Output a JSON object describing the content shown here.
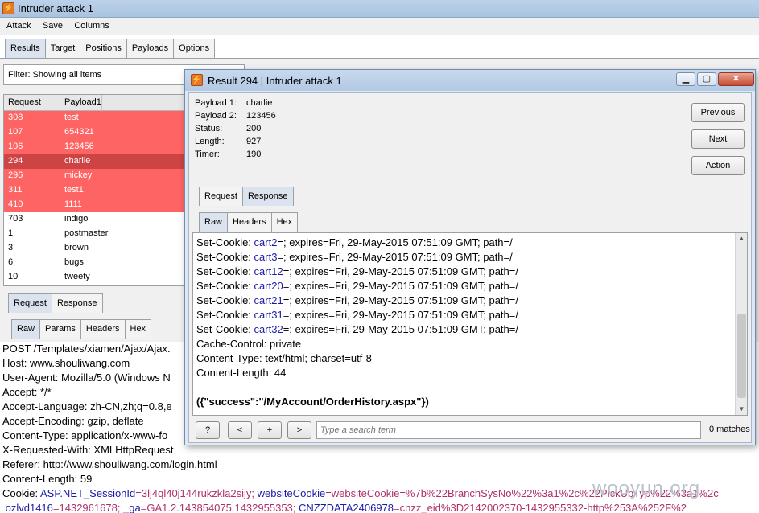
{
  "window": {
    "title": "Intruder attack 1",
    "icon": "burp-logo-icon"
  },
  "menu": [
    "Attack",
    "Save",
    "Columns"
  ],
  "main_tabs": [
    "Results",
    "Target",
    "Positions",
    "Payloads",
    "Options"
  ],
  "filter_text": "Filter:  Showing all items",
  "results": {
    "columns": [
      "Request",
      "Payload1"
    ],
    "rows": [
      [
        "308",
        "test"
      ],
      [
        "107",
        "654321"
      ],
      [
        "106",
        "123456"
      ],
      [
        "294",
        "charlie"
      ],
      [
        "296",
        "mickey"
      ],
      [
        "311",
        "test1"
      ],
      [
        "410",
        "1111"
      ],
      [
        "703",
        "indigo"
      ],
      [
        "1",
        "postmaster"
      ],
      [
        "3",
        "brown"
      ],
      [
        "6",
        "bugs"
      ],
      [
        "10",
        "tweety"
      ]
    ]
  },
  "req_tabs": [
    "Request",
    "Response"
  ],
  "req_sub_tabs": [
    "Raw",
    "Params",
    "Headers",
    "Hex"
  ],
  "request_lines": [
    "POST /Templates/xiamen/Ajax/Ajax.",
    "Host: www.shouliwang.com",
    "User-Agent: Mozilla/5.0 (Windows N",
    "Accept: */*",
    "Accept-Language: zh-CN,zh;q=0.8,e",
    "Accept-Encoding: gzip, deflate",
    "Content-Type: application/x-www-fo",
    "X-Requested-With: XMLHttpRequest",
    "Referer: http://www.shouliwang.com/login.html",
    "Content-Length: 59"
  ],
  "cookie_line": {
    "prefix": "Cookie: ",
    "k1": "ASP.NET_SessionId",
    "v1": "=3lj4ql40j144rukzkla2sijy;",
    "k2": " websiteCookie",
    "v2": "=websiteCookie=%7b%22BranchSysNo%22%3a1%2c%22PickUpTyp%22%3a1%2c"
  },
  "cookie_line2": {
    "k1": "ozlvd1416",
    "v1": "=1432961678;",
    "k2": " _ga",
    "v2": "=GA1.2.143854075.1432955353;",
    "k3": " CNZZDATA2406978",
    "v3": "=cnzz_eid%3D2142002370-1432955332-http%253A%252F%2"
  },
  "dialog": {
    "title": "Result 294 | Intruder attack 1",
    "info": [
      [
        "Payload 1:",
        "charlie"
      ],
      [
        "Payload 2:",
        "123456"
      ],
      [
        "Status:",
        "200"
      ],
      [
        "Length:",
        "927"
      ],
      [
        "Timer:",
        "190"
      ]
    ],
    "buttons": [
      "Previous",
      "Next",
      "Action"
    ],
    "tabs": [
      "Request",
      "Response"
    ],
    "sub_tabs": [
      "Raw",
      "Headers",
      "Hex"
    ],
    "response_cookies": [
      [
        "cart2",
        "=; expires=Fri, 29-May-2015 07:51:09 GMT; path=/"
      ],
      [
        "cart3",
        "=; expires=Fri, 29-May-2015 07:51:09 GMT; path=/"
      ],
      [
        "cart12",
        "=; expires=Fri, 29-May-2015 07:51:09 GMT; path=/"
      ],
      [
        "cart20",
        "=; expires=Fri, 29-May-2015 07:51:09 GMT; path=/"
      ],
      [
        "cart21",
        "=; expires=Fri, 29-May-2015 07:51:09 GMT; path=/"
      ],
      [
        "cart31",
        "=; expires=Fri, 29-May-2015 07:51:09 GMT; path=/"
      ],
      [
        "cart32",
        "=; expires=Fri, 29-May-2015 07:51:09 GMT; path=/"
      ]
    ],
    "cookie_prefix": "Set-Cookie: ",
    "response_tail": [
      "Cache-Control: private",
      "Content-Type: text/html; charset=utf-8",
      "Content-Length: 44"
    ],
    "response_body": "({\"success\":\"/MyAccount/OrderHistory.aspx\"})",
    "search_buttons": [
      "?",
      "<",
      "+",
      ">"
    ],
    "search_placeholder": "Type a search term",
    "matches": "0 matches"
  },
  "watermark": "wooyun.org",
  "colors": {
    "highlight_red": "#ff6464",
    "selected_red": "#cc4444",
    "cookie_key_blue": "#1a1aa8",
    "cookie_val_pink": "#b0306a"
  }
}
